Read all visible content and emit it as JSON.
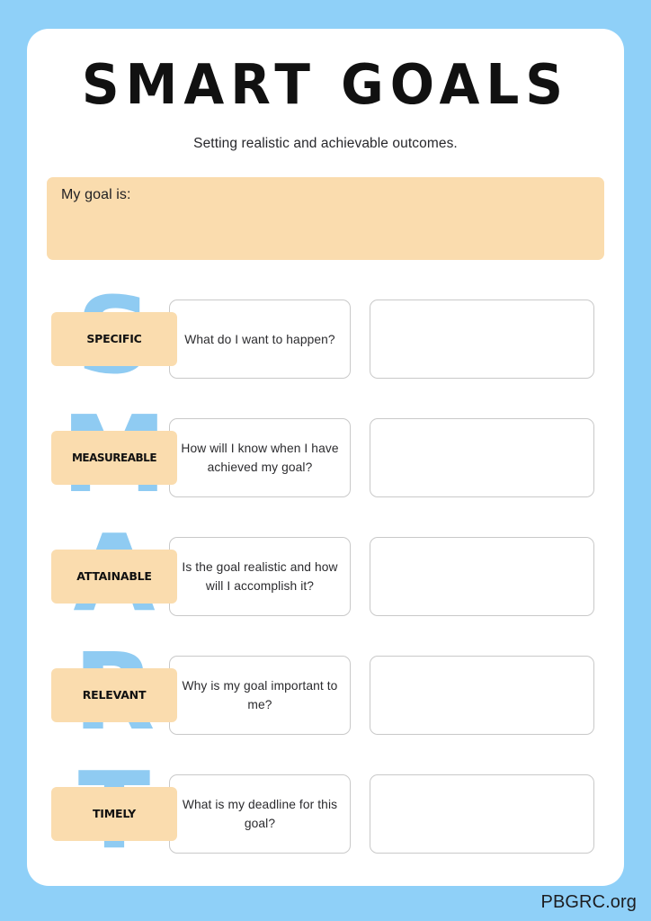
{
  "page": {
    "background_color": "#8FD0F8",
    "card_color": "#FFFFFF",
    "accent_peach": "#FADCAE",
    "accent_blue": "#8FCBF2",
    "border_gray": "#C9C9C9"
  },
  "header": {
    "title": "SMART GOALS",
    "subtitle": "Setting realistic and achievable outcomes."
  },
  "goal_banner": {
    "label": "My goal is:",
    "value": ""
  },
  "rows": [
    {
      "letter": "S",
      "label": "SPECIFIC",
      "question": "What do I want to happen?",
      "answer": ""
    },
    {
      "letter": "M",
      "label": "MEASUREABLE",
      "question": "How will I know when I have achieved my goal?",
      "answer": ""
    },
    {
      "letter": "A",
      "label": "ATTAINABLE",
      "question": "Is the goal realistic and how will I accomplish it?",
      "answer": ""
    },
    {
      "letter": "R",
      "label": "RELEVANT",
      "question": "Why is my goal important to me?",
      "answer": ""
    },
    {
      "letter": "T",
      "label": "TIMELY",
      "question": "What is my deadline for this goal?",
      "answer": ""
    }
  ],
  "footer": {
    "watermark": "PBGRC.org"
  }
}
